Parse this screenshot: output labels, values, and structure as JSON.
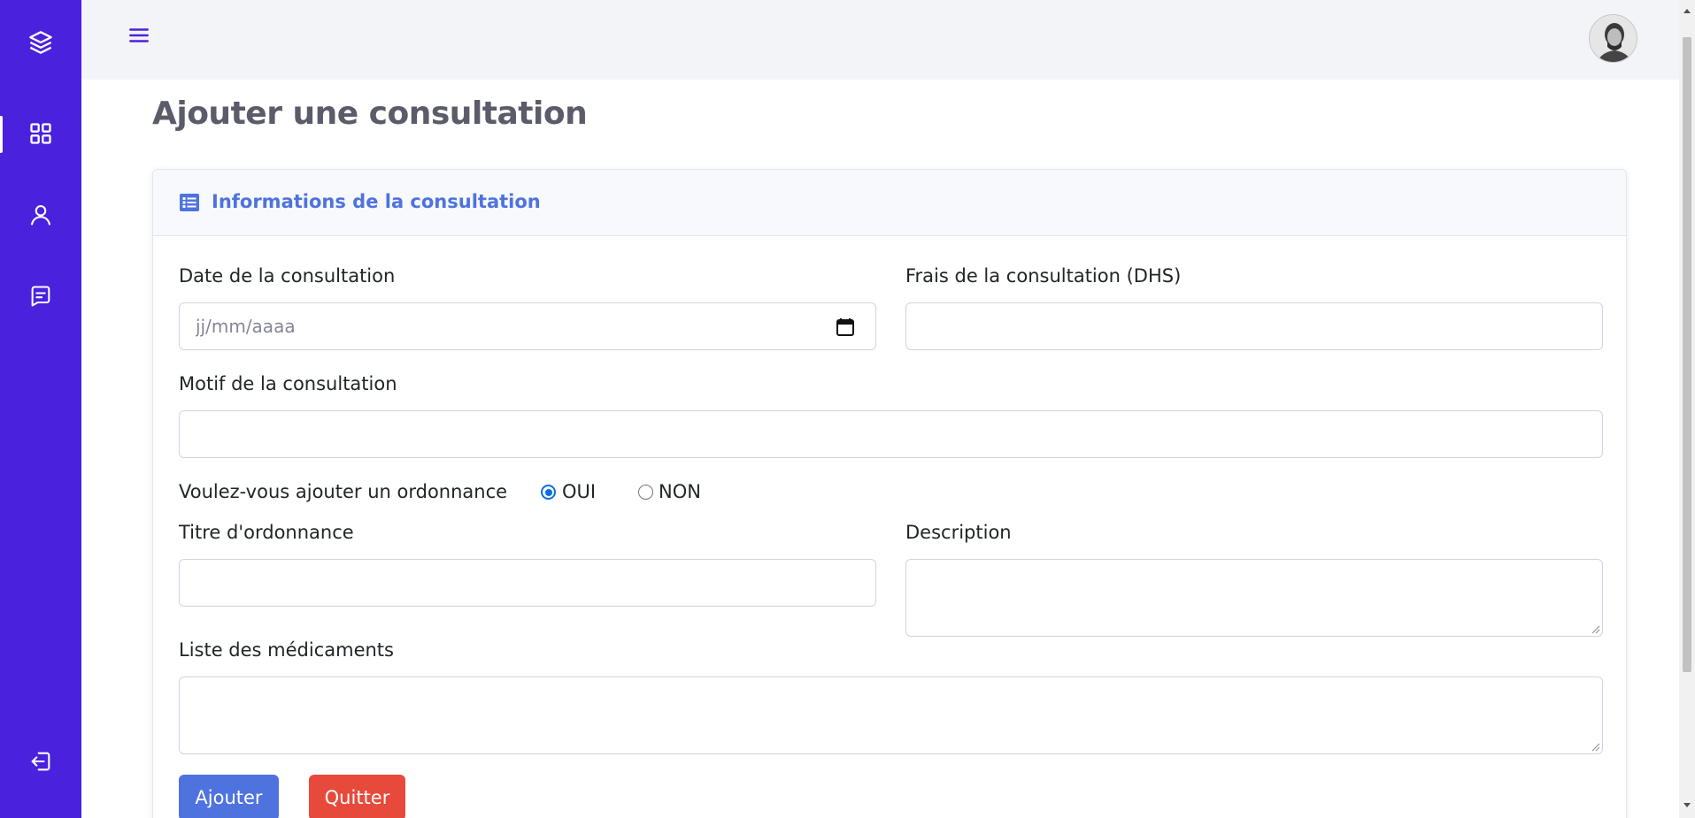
{
  "sidebar": {
    "items": [
      {
        "icon": "layers-icon"
      },
      {
        "icon": "dashboard-icon",
        "active": true
      },
      {
        "icon": "user-icon"
      },
      {
        "icon": "message-icon"
      },
      {
        "icon": "logout-icon"
      }
    ],
    "color": "#4a21dd"
  },
  "header": {
    "menu_icon": "menu-icon",
    "avatar": "user-avatar"
  },
  "page": {
    "title": "Ajouter une consultation"
  },
  "card": {
    "title": "Informations de la consultation",
    "icon": "list-icon",
    "accent": "#4e73df"
  },
  "form": {
    "date": {
      "label": "Date de la consultation",
      "placeholder": "jj/mm/aaaa",
      "value": ""
    },
    "fees": {
      "label": "Frais de la consultation (DHS)",
      "value": ""
    },
    "reason": {
      "label": "Motif de la consultation",
      "value": ""
    },
    "prescription_question": {
      "label": "Voulez-vous ajouter un ordonnance",
      "options": [
        {
          "label": "OUI",
          "checked": true
        },
        {
          "label": "NON",
          "checked": false
        }
      ]
    },
    "prescription_title": {
      "label": "Titre d'ordonnance",
      "value": ""
    },
    "description": {
      "label": "Description",
      "value": ""
    },
    "medications": {
      "label": "Liste des médicaments",
      "value": ""
    }
  },
  "actions": {
    "submit_label": "Ajouter",
    "submit_color": "#4e73df",
    "cancel_label": "Quitter",
    "cancel_color": "#e74a3b"
  }
}
